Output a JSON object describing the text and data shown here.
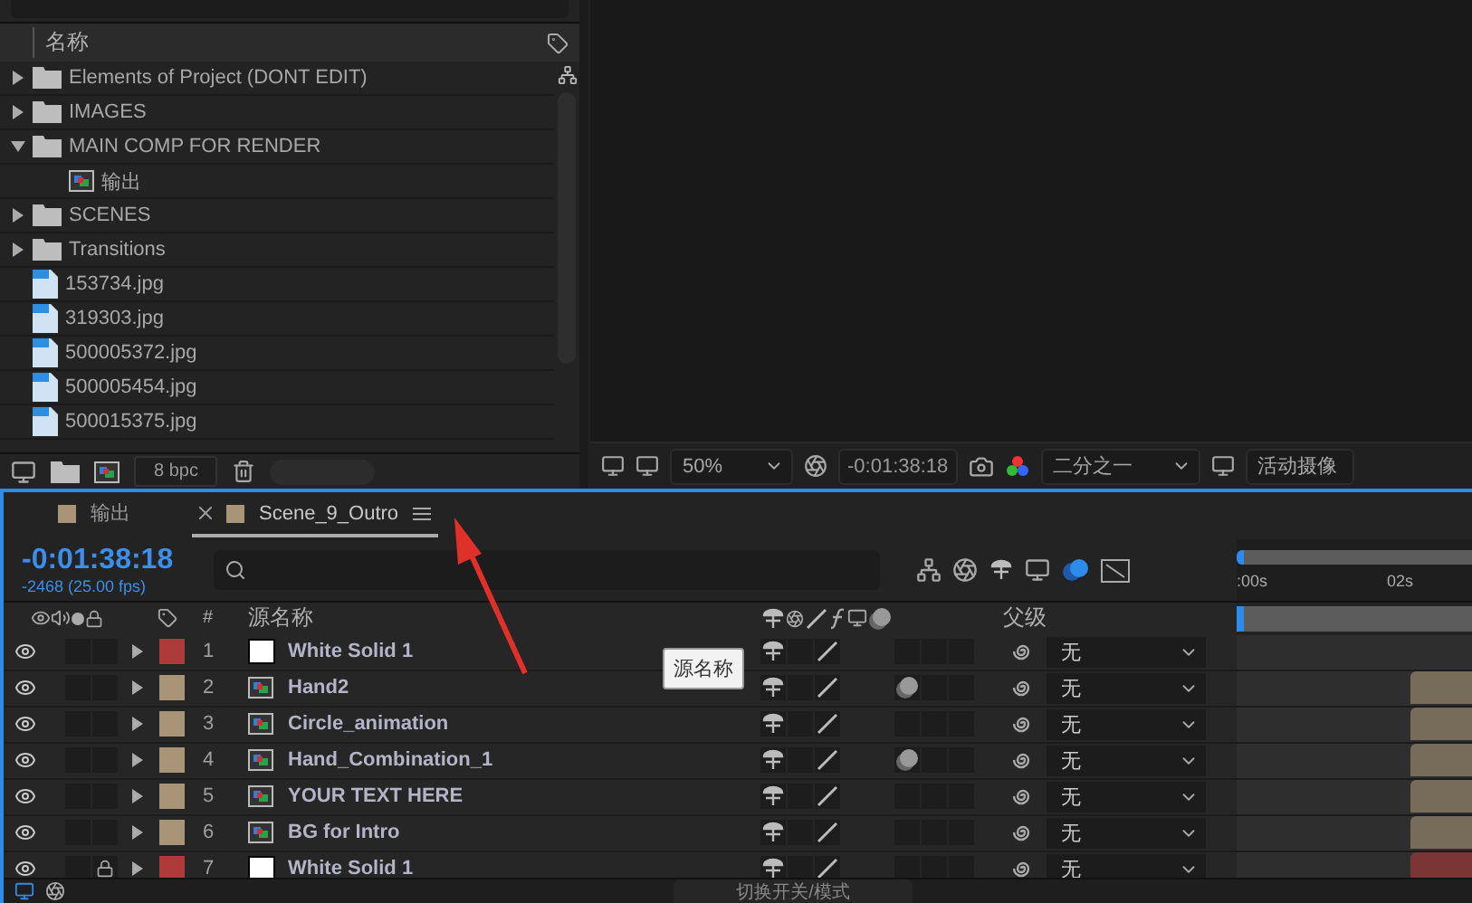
{
  "project": {
    "column_header": "名称",
    "items": [
      {
        "kind": "folder",
        "name": "Elements of Project (DONT EDIT)",
        "expanded": false
      },
      {
        "kind": "folder",
        "name": "IMAGES",
        "expanded": false
      },
      {
        "kind": "folder",
        "name": "MAIN COMP FOR RENDER",
        "expanded": true,
        "children": [
          {
            "kind": "comp",
            "name": "输出"
          }
        ]
      },
      {
        "kind": "folder",
        "name": "SCENES",
        "expanded": false
      },
      {
        "kind": "folder",
        "name": "Transitions",
        "expanded": false
      },
      {
        "kind": "image",
        "name": "153734.jpg"
      },
      {
        "kind": "image",
        "name": "319303.jpg"
      },
      {
        "kind": "image",
        "name": "500005372.jpg"
      },
      {
        "kind": "image",
        "name": "500005454.jpg"
      },
      {
        "kind": "image",
        "name": "500015375.jpg"
      }
    ],
    "bit_depth": "8 bpc"
  },
  "viewer": {
    "zoom": "50%",
    "timecode": "-0:01:38:18",
    "resolution": "二分之一",
    "camera": "活动摄像"
  },
  "timeline": {
    "tabs": [
      {
        "label": "输出",
        "selected": false
      },
      {
        "label": "Scene_9_Outro",
        "selected": true
      }
    ],
    "timecode": "-0:01:38:18",
    "frame_info": "-2468 (25.00 fps)",
    "ruler_labels": [
      ":00s",
      "02s"
    ],
    "columns": {
      "number": "#",
      "source_name": "源名称",
      "parent": "父级"
    },
    "layers": [
      {
        "number": "1",
        "name": "White Solid 1",
        "color": "#b03a3a",
        "kind": "solid",
        "locked": false,
        "motion_blur": false,
        "parent": "无",
        "bar": false
      },
      {
        "number": "2",
        "name": "Hand2",
        "color": "#a89578",
        "kind": "comp",
        "locked": false,
        "motion_blur": true,
        "parent": "无",
        "bar": true
      },
      {
        "number": "3",
        "name": "Circle_animation",
        "color": "#a89578",
        "kind": "comp",
        "locked": false,
        "motion_blur": false,
        "parent": "无",
        "bar": true
      },
      {
        "number": "4",
        "name": "Hand_Combination_1",
        "color": "#a89578",
        "kind": "comp",
        "locked": false,
        "motion_blur": true,
        "parent": "无",
        "bar": true
      },
      {
        "number": "5",
        "name": "YOUR TEXT HERE",
        "color": "#a89578",
        "kind": "comp",
        "locked": false,
        "motion_blur": false,
        "parent": "无",
        "bar": true
      },
      {
        "number": "6",
        "name": "BG for Intro",
        "color": "#a89578",
        "kind": "comp",
        "locked": false,
        "motion_blur": false,
        "parent": "无",
        "bar": true
      },
      {
        "number": "7",
        "name": "White Solid 1",
        "color": "#b03a3a",
        "kind": "solid",
        "locked": true,
        "motion_blur": false,
        "parent": "无",
        "bar": true
      }
    ],
    "tooltip": "源名称",
    "footer": "切换开关/模式"
  }
}
